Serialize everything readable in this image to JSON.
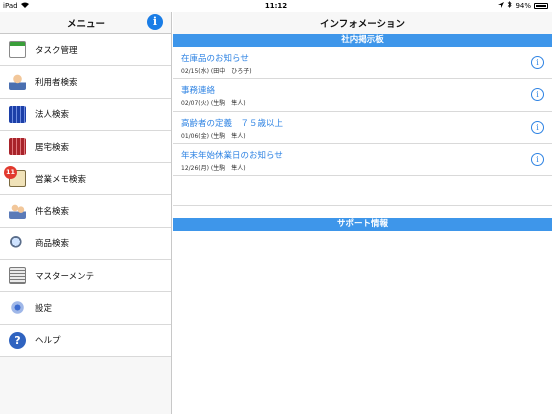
{
  "statusbar": {
    "device": "iPad",
    "time": "11:12",
    "battery": "94%"
  },
  "sidebar": {
    "title": "メニュー",
    "items": [
      {
        "label": "タスク管理",
        "icon": "task-list-icon"
      },
      {
        "label": "利用者検索",
        "icon": "user-icon"
      },
      {
        "label": "法人検索",
        "icon": "corporation-building-icon"
      },
      {
        "label": "居宅検索",
        "icon": "home-building-icon"
      },
      {
        "label": "営業メモ検索",
        "icon": "memo-clipboard-icon",
        "badge": "11"
      },
      {
        "label": "件名検索",
        "icon": "people-icon"
      },
      {
        "label": "商品検索",
        "icon": "magnifier-icon"
      },
      {
        "label": "マスターメンテ",
        "icon": "keyboard-icon"
      },
      {
        "label": "設定",
        "icon": "gear-icon"
      },
      {
        "label": "ヘルプ",
        "icon": "help-icon"
      }
    ]
  },
  "main": {
    "title": "インフォメーション",
    "bulletin": {
      "header": "社内掲示板",
      "notices": [
        {
          "title": "在庫品のお知らせ",
          "meta": "02/15(水) (田中　ひろ子)"
        },
        {
          "title": "事務連絡",
          "meta": "02/07(火) (生駒　隼人)"
        },
        {
          "title": "高齢者の定義　７５歳以上",
          "meta": "01/06(金) (生駒　隼人)"
        },
        {
          "title": "年末年始休業日のお知らせ",
          "meta": "12/26(月) (生駒　隼人)"
        }
      ]
    },
    "support": {
      "header": "サポート情報"
    }
  }
}
